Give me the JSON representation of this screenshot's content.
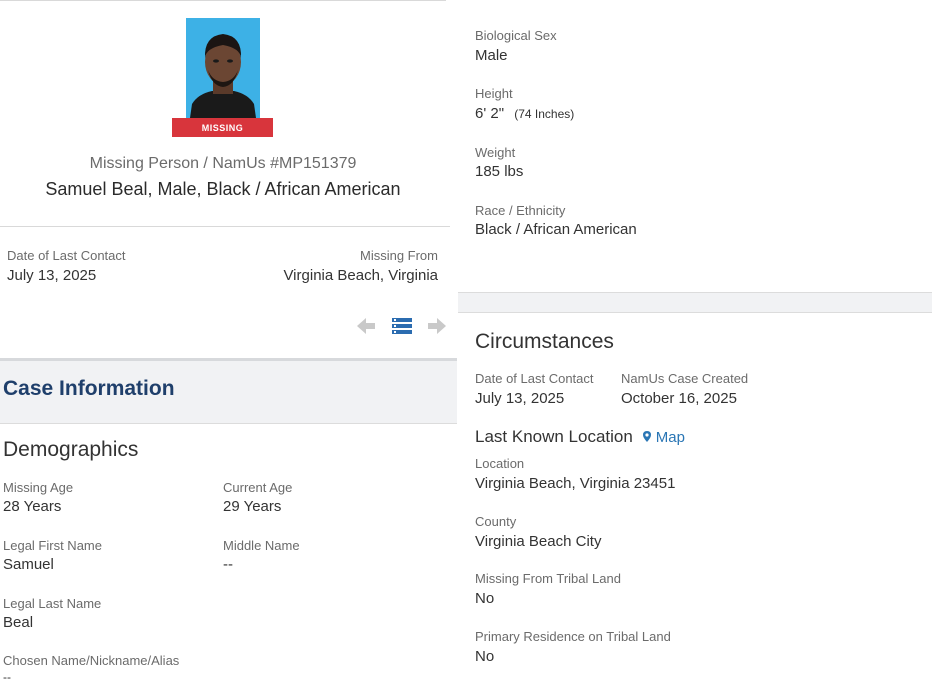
{
  "profile": {
    "photo_badge": "MISSING",
    "case_id": "Missing Person / NamUs #MP151379",
    "summary": "Samuel Beal, Male, Black / African American"
  },
  "contact": {
    "last_contact_label": "Date of Last Contact",
    "last_contact_value": "July 13, 2025",
    "missing_from_label": "Missing From",
    "missing_from_value": "Virginia Beach, Virginia"
  },
  "nav_icons": [
    "arrow-left-icon",
    "list-icon",
    "arrow-right-icon"
  ],
  "case_information": {
    "title": "Case Information"
  },
  "demographics": {
    "title": "Demographics",
    "missing_age_label": "Missing Age",
    "missing_age_value": "28 Years",
    "current_age_label": "Current Age",
    "current_age_value": "29 Years",
    "first_name_label": "Legal First Name",
    "first_name_value": "Samuel",
    "middle_name_label": "Middle Name",
    "middle_name_value": "--",
    "last_name_label": "Legal Last Name",
    "last_name_value": "Beal",
    "alias_label": "Chosen Name/Nickname/Alias",
    "alias_value": "--"
  },
  "physical": {
    "sex_label": "Biological Sex",
    "sex_value": "Male",
    "height_label": "Height",
    "height_value": "6' 2\"",
    "height_inches": "(74 Inches)",
    "weight_label": "Weight",
    "weight_value": "185 lbs",
    "race_label": "Race / Ethnicity",
    "race_value": "Black / African American"
  },
  "circumstances": {
    "title": "Circumstances",
    "last_contact_label": "Date of Last Contact",
    "last_contact_value": "July 13, 2025",
    "case_created_label": "NamUs Case Created",
    "case_created_value": "October 16, 2025",
    "last_known_location_title": "Last Known Location",
    "map_link": "Map",
    "location_label": "Location",
    "location_value": "Virginia Beach, Virginia 23451",
    "county_label": "County",
    "county_value": "Virginia Beach City",
    "tribal_land_label": "Missing From Tribal Land",
    "tribal_land_value": "No",
    "residence_tribal_label": "Primary Residence on Tribal Land",
    "residence_tribal_value": "No"
  },
  "colors": {
    "accent_blue": "#1f3f6b",
    "badge_red": "#d8353c",
    "link_blue": "#2a76b5",
    "icon_gray": "#c9c9c9",
    "icon_blue": "#2b6cb0"
  }
}
